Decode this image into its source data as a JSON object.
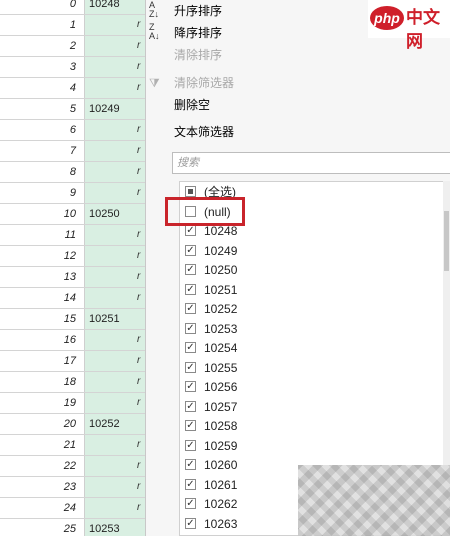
{
  "grid": {
    "rows": [
      {
        "idx": "0",
        "value": "10248"
      },
      {
        "idx": "1",
        "value": ""
      },
      {
        "idx": "2",
        "value": ""
      },
      {
        "idx": "3",
        "value": ""
      },
      {
        "idx": "4",
        "value": ""
      },
      {
        "idx": "5",
        "value": "10249"
      },
      {
        "idx": "6",
        "value": ""
      },
      {
        "idx": "7",
        "value": ""
      },
      {
        "idx": "8",
        "value": ""
      },
      {
        "idx": "9",
        "value": ""
      },
      {
        "idx": "10",
        "value": "10250"
      },
      {
        "idx": "11",
        "value": ""
      },
      {
        "idx": "12",
        "value": ""
      },
      {
        "idx": "13",
        "value": ""
      },
      {
        "idx": "14",
        "value": ""
      },
      {
        "idx": "15",
        "value": "10251"
      },
      {
        "idx": "16",
        "value": ""
      },
      {
        "idx": "17",
        "value": ""
      },
      {
        "idx": "18",
        "value": ""
      },
      {
        "idx": "19",
        "value": ""
      },
      {
        "idx": "20",
        "value": "10252"
      },
      {
        "idx": "21",
        "value": ""
      },
      {
        "idx": "22",
        "value": ""
      },
      {
        "idx": "23",
        "value": ""
      },
      {
        "idx": "24",
        "value": ""
      },
      {
        "idx": "25",
        "value": "10253"
      }
    ],
    "right_mark": "r"
  },
  "menu": {
    "sort_asc": "升序排序",
    "sort_desc": "降序排序",
    "clear_sort": "清除排序",
    "clear_filter": "清除筛选器",
    "remove_empty": "删除空",
    "text_filter": "文本筛选器"
  },
  "search": {
    "placeholder": "搜索"
  },
  "filter_list": [
    {
      "label": "(全选)",
      "state": "partial"
    },
    {
      "label": "(null)",
      "state": "unchecked"
    },
    {
      "label": "10248",
      "state": "checked"
    },
    {
      "label": "10249",
      "state": "checked"
    },
    {
      "label": "10250",
      "state": "checked"
    },
    {
      "label": "10251",
      "state": "checked"
    },
    {
      "label": "10252",
      "state": "checked"
    },
    {
      "label": "10253",
      "state": "checked"
    },
    {
      "label": "10254",
      "state": "checked"
    },
    {
      "label": "10255",
      "state": "checked"
    },
    {
      "label": "10256",
      "state": "checked"
    },
    {
      "label": "10257",
      "state": "checked"
    },
    {
      "label": "10258",
      "state": "checked"
    },
    {
      "label": "10259",
      "state": "checked"
    },
    {
      "label": "10260",
      "state": "checked"
    },
    {
      "label": "10261",
      "state": "checked"
    },
    {
      "label": "10262",
      "state": "checked"
    },
    {
      "label": "10263",
      "state": "checked"
    }
  ],
  "logo": {
    "badge": "php",
    "text": "中文网"
  },
  "colors": {
    "highlight": "#c9242b",
    "column_shade": "#d9efe2",
    "brand": "#cf1f2a"
  }
}
